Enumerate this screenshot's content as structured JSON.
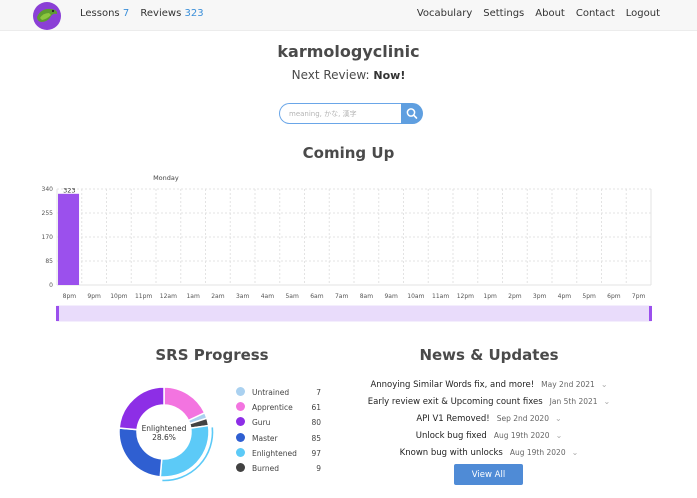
{
  "nav": {
    "lessons_label": "Lessons",
    "lessons_count": "7",
    "reviews_label": "Reviews",
    "reviews_count": "323",
    "links": [
      "Vocabulary",
      "Settings",
      "About",
      "Contact",
      "Logout"
    ]
  },
  "user": {
    "name": "karmologyclinic",
    "next_review_label": "Next Review:",
    "next_review_value": "Now!"
  },
  "search": {
    "placeholder": "meaning, かな, 漢字"
  },
  "coming_up": {
    "title": "Coming Up"
  },
  "chart_data": {
    "type": "bar",
    "annotation": "Monday",
    "categories": [
      "8pm",
      "9pm",
      "10pm",
      "11pm",
      "12am",
      "1am",
      "2am",
      "3am",
      "4am",
      "5am",
      "6am",
      "7am",
      "8am",
      "9am",
      "10am",
      "11am",
      "12pm",
      "1pm",
      "2pm",
      "3pm",
      "4pm",
      "5pm",
      "6pm",
      "7pm"
    ],
    "values": [
      323,
      0,
      0,
      0,
      0,
      0,
      0,
      0,
      0,
      0,
      0,
      0,
      0,
      0,
      0,
      0,
      0,
      0,
      0,
      0,
      0,
      0,
      0,
      0
    ],
    "data_labels": [
      "323"
    ],
    "y_ticks": [
      0,
      85,
      170,
      255,
      340
    ],
    "ylim": [
      0,
      340
    ],
    "grid": true,
    "colors": {
      "bar": "#9b50ed",
      "grid": "#e3e3e3",
      "slider": "#e9dcfb",
      "slider_border": "#9b50ed"
    }
  },
  "srs": {
    "title": "SRS Progress",
    "center_label": "Enlightened",
    "center_value": "28.6%",
    "stages": [
      {
        "name": "Untrained",
        "count": "7",
        "value": 7,
        "color": "#aad1f0",
        "icon": "untrained-icon"
      },
      {
        "name": "Apprentice",
        "count": "61",
        "value": 61,
        "color": "#f374e0",
        "icon": "apprentice-icon"
      },
      {
        "name": "Guru",
        "count": "80",
        "value": 80,
        "color": "#8d2ee6",
        "icon": "guru-icon"
      },
      {
        "name": "Master",
        "count": "85",
        "value": 85,
        "color": "#2f5fd1",
        "icon": "master-icon"
      },
      {
        "name": "Enlightened",
        "count": "97",
        "value": 97,
        "color": "#5ccaf7",
        "icon": "enlightened-icon"
      },
      {
        "name": "Burned",
        "count": "9",
        "value": 9,
        "color": "#424242",
        "icon": "burned-icon"
      }
    ]
  },
  "news": {
    "title": "News & Updates",
    "items": [
      {
        "title": "Annoying Similar Words fix, and more!",
        "date": "May 2nd 2021"
      },
      {
        "title": "Early review exit & Upcoming count fixes",
        "date": "Jan 5th 2021"
      },
      {
        "title": "API V1 Removed!",
        "date": "Sep 2nd 2020"
      },
      {
        "title": "Unlock bug fixed",
        "date": "Aug 19th 2020"
      },
      {
        "title": "Known bug with unlocks",
        "date": "Aug 19th 2020"
      }
    ],
    "view_all_label": "View All"
  }
}
